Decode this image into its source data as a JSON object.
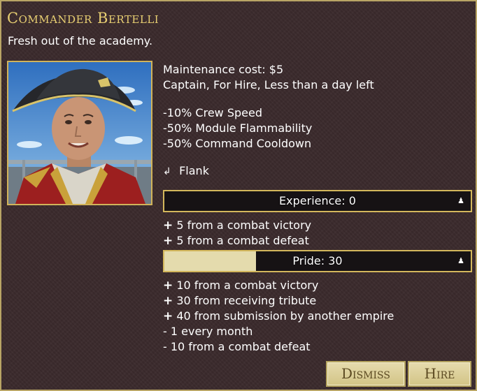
{
  "commander": {
    "name": "Commander Bertelli",
    "description": "Fresh out of the academy."
  },
  "details": {
    "maintenance": "Maintenance cost: $5",
    "status": "Captain, For Hire, Less than a day left"
  },
  "modifiers": [
    "-10% Crew Speed",
    "-50% Module Flammability",
    "-50% Command Cooldown"
  ],
  "ability": {
    "icon": "flank-arrow-icon",
    "label": "Flank"
  },
  "experience": {
    "label": "Experience: 0",
    "fill_fraction": 0,
    "icon": "person-icon",
    "sources": [
      {
        "sign": "+",
        "text": "5 from a combat victory"
      },
      {
        "sign": "+",
        "text": "5 from a combat defeat"
      }
    ]
  },
  "pride": {
    "label": "Pride: 30",
    "fill_fraction": 0.3,
    "icon": "person-icon",
    "sources": [
      {
        "sign": "+",
        "text": "10 from a combat victory"
      },
      {
        "sign": "+",
        "text": "30 from receiving tribute"
      },
      {
        "sign": "+",
        "text": "40 from submission by another empire"
      },
      {
        "sign": "-",
        "text": "1 every month"
      },
      {
        "sign": "-",
        "text": "10 from a combat defeat"
      }
    ]
  },
  "buttons": {
    "dismiss": "Dismiss",
    "hire": "Hire"
  },
  "colors": {
    "title": "#e8cf72",
    "border": "#d1b35a",
    "bar_fill": "#e4dbad",
    "panel_bg": "#3a2a2c"
  }
}
